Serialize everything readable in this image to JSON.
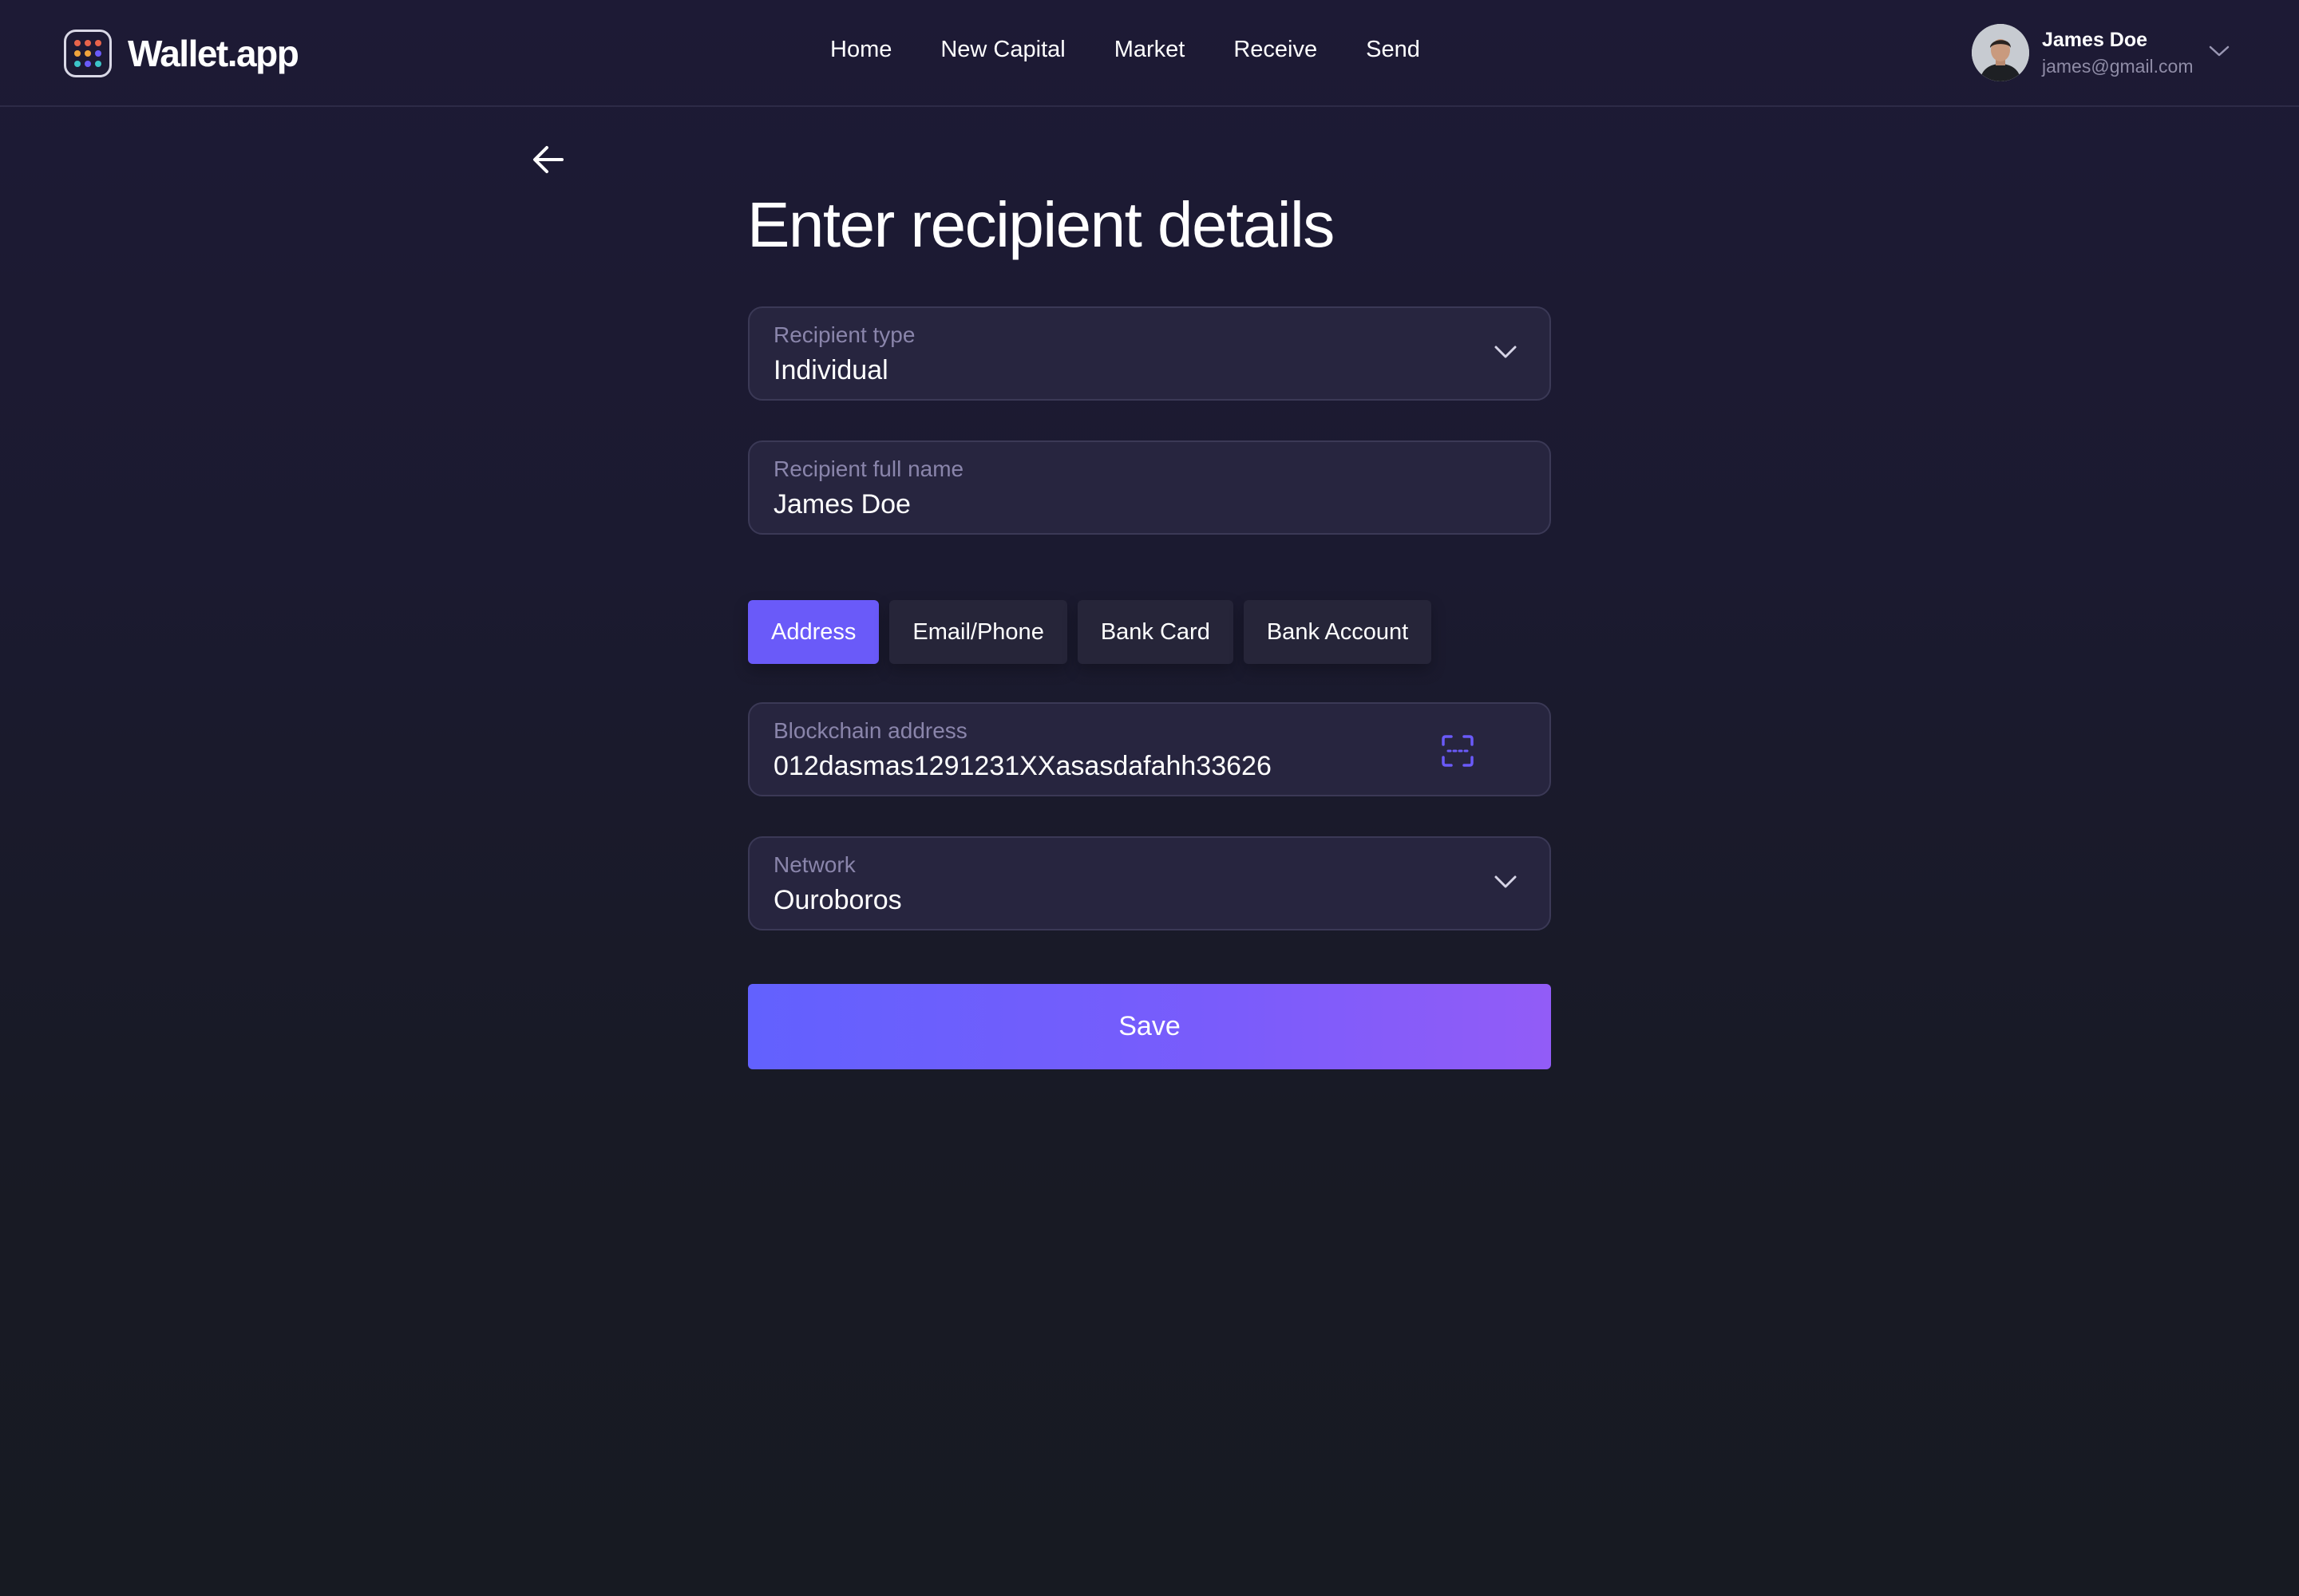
{
  "header": {
    "app_name": "Wallet.app",
    "nav": [
      "Home",
      "New Capital",
      "Market",
      "Receive",
      "Send"
    ],
    "user": {
      "name": "James Doe",
      "email": "james@gmail.com"
    }
  },
  "page": {
    "title": "Enter recipient details"
  },
  "form": {
    "recipient_type": {
      "label": "Recipient type",
      "value": "Individual"
    },
    "full_name": {
      "label": "Recipient full name",
      "value": "James Doe"
    },
    "tabs": [
      {
        "label": "Address",
        "active": true
      },
      {
        "label": "Email/Phone",
        "active": false
      },
      {
        "label": "Bank Card",
        "active": false
      },
      {
        "label": "Bank Account",
        "active": false
      }
    ],
    "blockchain_address": {
      "label": "Blockchain address",
      "value": "012dasmas1291231XXasasdafahh33626"
    },
    "network": {
      "label": "Network",
      "value": "Ouroboros"
    },
    "save_label": "Save"
  },
  "colors": {
    "accent": "#6a5af9",
    "background": "#1b1a30",
    "field_bg": "#27253f",
    "label": "#8a85ab"
  },
  "icons": {
    "logo": "dot-grid-icon",
    "back": "arrow-left-icon",
    "dropdown": "chevron-down-icon",
    "scan": "qr-scan-icon"
  }
}
